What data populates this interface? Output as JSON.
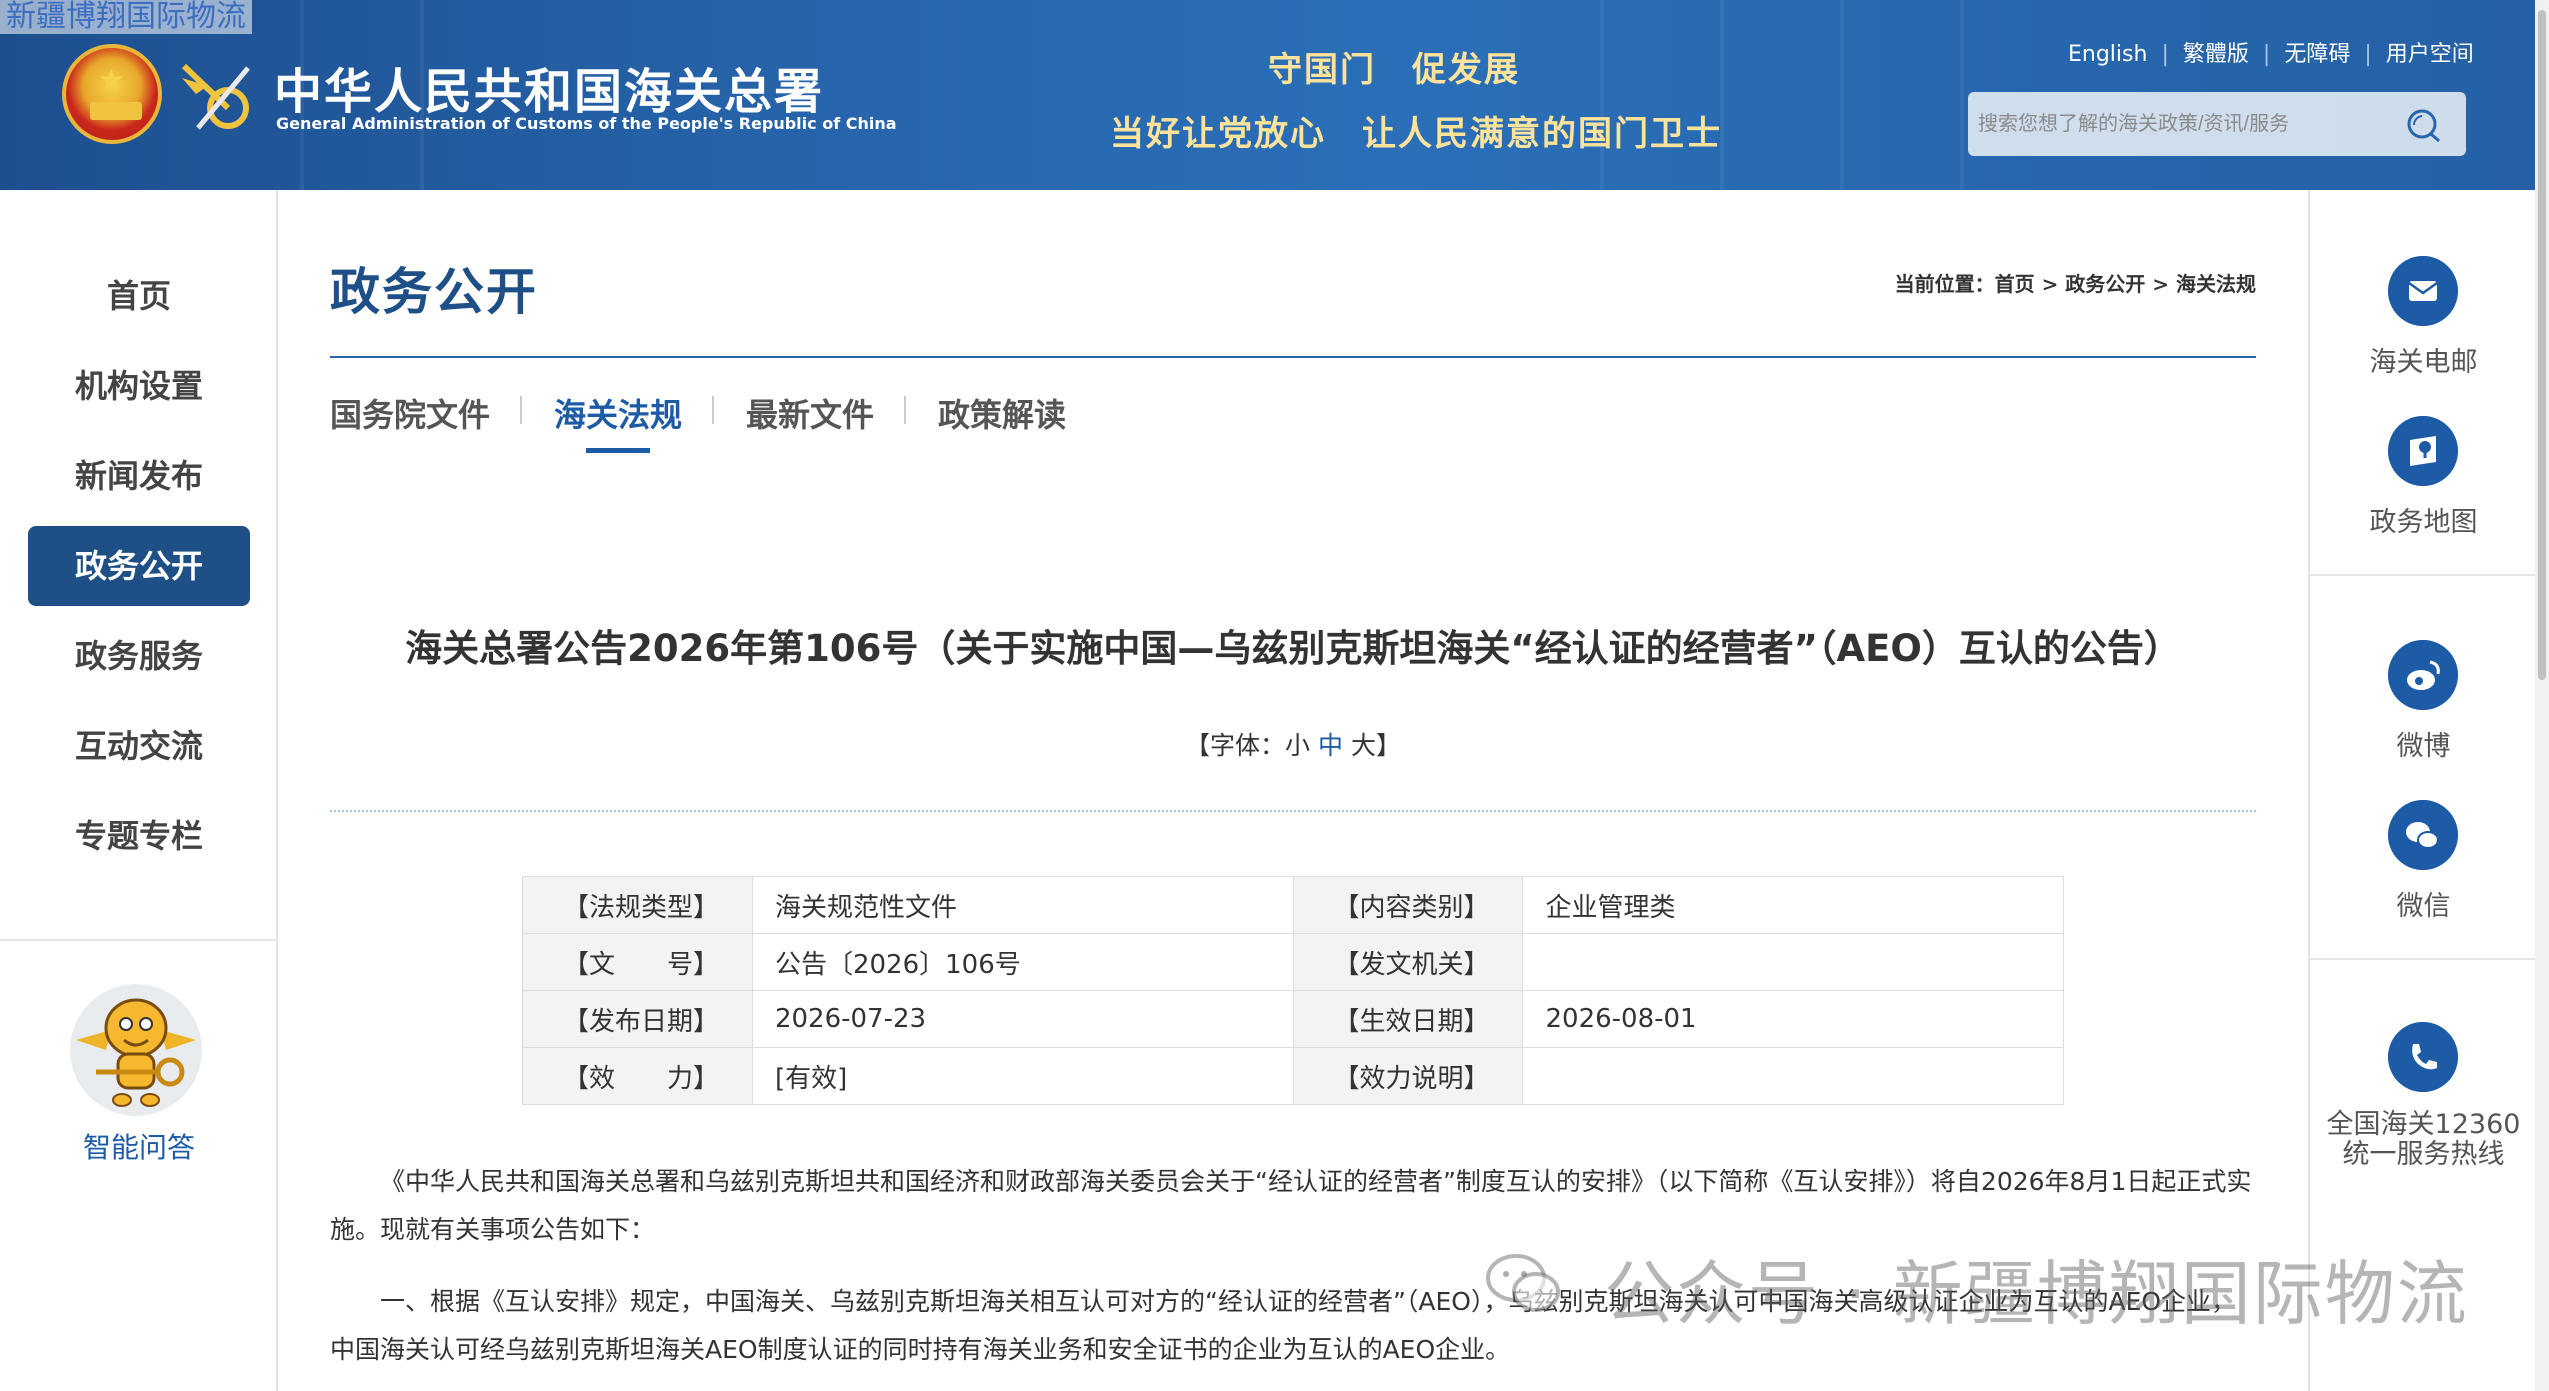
{
  "header": {
    "watermark_top": "新疆博翔国际物流",
    "title_cn": "中华人民共和国海关总署",
    "title_en": "General Administration of Customs of the People's Republic of China",
    "slogan_line1": "守国门　促发展",
    "slogan_line2": "当好让党放心　让人民满意的国门卫士",
    "links": [
      "English",
      "繁體版",
      "无障碍",
      "用户空间"
    ],
    "search_placeholder": "搜索您想了解的海关政策/资讯/服务",
    "color": "#2766ad"
  },
  "left_nav": {
    "items": [
      {
        "label": "首页",
        "active": false
      },
      {
        "label": "机构设置",
        "active": false
      },
      {
        "label": "新闻发布",
        "active": false
      },
      {
        "label": "政务公开",
        "active": true
      },
      {
        "label": "政务服务",
        "active": false
      },
      {
        "label": "互动交流",
        "active": false
      },
      {
        "label": "专题专栏",
        "active": false
      }
    ],
    "qa_label": "智能问答",
    "active_color": "#1e4f86"
  },
  "right_bar": {
    "items": [
      {
        "label": "海关电邮",
        "icon": "mail-icon"
      },
      {
        "label": "政务地图",
        "icon": "map-icon"
      },
      {
        "label": "微博",
        "icon": "weibo-icon"
      },
      {
        "label": "微信",
        "icon": "wechat-icon"
      },
      {
        "label_line1": "全国海关12360",
        "label_line2": "统一服务热线",
        "icon": "phone-icon"
      }
    ]
  },
  "main": {
    "section_title": "政务公开",
    "breadcrumb": "当前位置：首页 > 政务公开 > 海关法规",
    "tabs": [
      {
        "label": "国务院文件",
        "active": false
      },
      {
        "label": "海关法规",
        "active": true
      },
      {
        "label": "最新文件",
        "active": false
      },
      {
        "label": "政策解读",
        "active": false
      }
    ],
    "doc_title": "海关总署公告2026年第106号（关于实施中国—乌兹别克斯坦海关“经认证的经营者”（AEO）互认的公告）",
    "font_size": {
      "prefix": "【字体：",
      "small": "小",
      "medium": "中",
      "large": "大",
      "suffix": "】"
    },
    "meta": [
      {
        "label1": "【法规类型】",
        "value1": "海关规范性文件",
        "label2": "【内容类别】",
        "value2": "企业管理类"
      },
      {
        "label1": "【文　　号】",
        "value1": "公告〔2026〕106号",
        "label2": "【发文机关】",
        "value2": ""
      },
      {
        "label1": "【发布日期】",
        "value1": "2026-07-23",
        "label2": "【生效日期】",
        "value2": "2026-08-01"
      },
      {
        "label1": "【效　　力】",
        "value1": "[有效]",
        "label2": "【效力说明】",
        "value2": ""
      }
    ],
    "paragraphs": [
      "《中华人民共和国海关总署和乌兹别克斯坦共和国经济和财政部海关委员会关于“经认证的经营者”制度互认的安排》（以下简称《互认安排》）将自2026年8月1日起正式实施。现就有关事项公告如下：",
      "一、根据《互认安排》规定，中国海关、乌兹别克斯坦海关相互认可对方的“经认证的经营者”（AEO），乌兹别克斯坦海关认可中国海关高级认证企业为互认的AEO企业，中国海关认可经乌兹别克斯坦海关AEO制度认证的同时持有海关业务和安全证书的企业为互认的AEO企业。"
    ]
  },
  "overlay_watermark": "公众号 · 新疆博翔国际物流"
}
